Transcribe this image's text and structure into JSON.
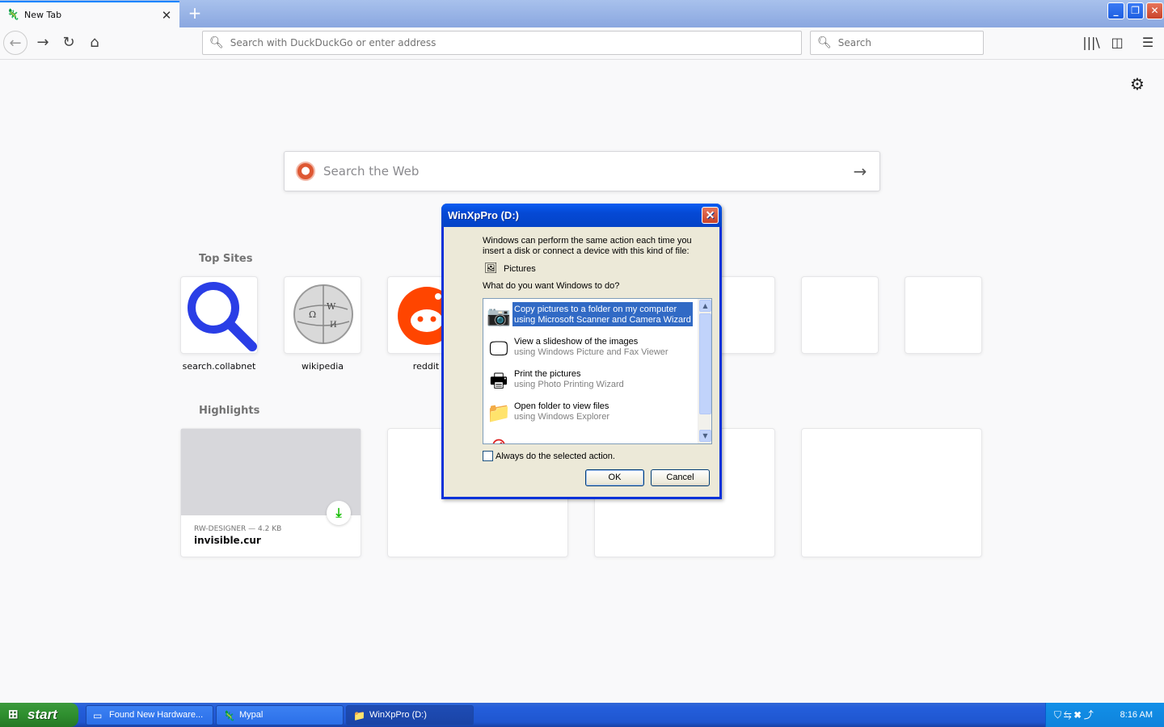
{
  "browser": {
    "tab_title": "New Tab",
    "tab_icon": "mypal-icon",
    "url_placeholder": "Search with DuckDuckGo or enter address",
    "search_placeholder": "Search"
  },
  "newtab": {
    "web_search_placeholder": "Search the Web",
    "top_sites_title": "Top Sites",
    "top_sites": [
      {
        "label": "search.collabnet",
        "icon": "magnifier-icon"
      },
      {
        "label": "wikipedia",
        "icon": "wikipedia-globe-icon"
      },
      {
        "label": "reddit",
        "icon": "reddit-icon"
      }
    ],
    "highlights_title": "Highlights",
    "highlight": {
      "meta": "RW-DESIGNER — 4.2 KB",
      "filename": "invisible.cur"
    }
  },
  "dialog": {
    "title": "WinXpPro (D:)",
    "intro": "Windows can perform the same action each time you insert a disk or connect a device with this kind of file:",
    "content_type": "Pictures",
    "question": "What do you want Windows to do?",
    "options": [
      {
        "main": "Copy pictures to a folder on my computer",
        "sub": "using Microsoft Scanner and Camera Wizard",
        "icon": "scanner-camera-icon"
      },
      {
        "main": "View a slideshow of the images",
        "sub": "using Windows Picture and Fax Viewer",
        "icon": "projector-screen-icon"
      },
      {
        "main": "Print the pictures",
        "sub": "using Photo Printing Wizard",
        "icon": "printer-icon"
      },
      {
        "main": "Open folder to view files",
        "sub": "using Windows Explorer",
        "icon": "folder-icon"
      }
    ],
    "always_label": "Always do the selected action.",
    "ok_label": "OK",
    "cancel_label": "Cancel"
  },
  "taskbar": {
    "start_label": "start",
    "tasks": [
      {
        "label": "Found New Hardware..."
      },
      {
        "label": "Mypal"
      },
      {
        "label": "WinXpPro (D:)"
      }
    ],
    "clock": "8:16 AM"
  }
}
